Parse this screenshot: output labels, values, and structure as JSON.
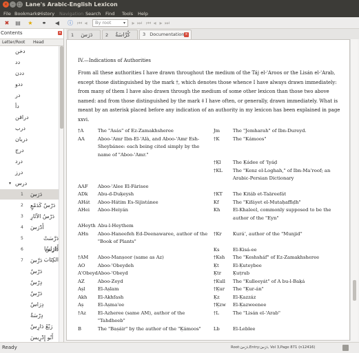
{
  "window": {
    "title": "Lane's Arabic-English Lexicon"
  },
  "menu": [
    "File",
    "Bookmarks",
    "History",
    "Navigation",
    "Search",
    "Find",
    "Tools",
    "Help"
  ],
  "menu_disabled": [
    false,
    false,
    false,
    true,
    false,
    false,
    false,
    false
  ],
  "toolbar": {
    "root_placeholder": "By root",
    "icons": [
      "delete-icon",
      "view-icon",
      "bookmark-icon",
      "binoculars-icon",
      "back-icon",
      "info-icon",
      "first-icon",
      "prev-icon",
      "next-icon",
      "last-icon",
      "page-first-icon",
      "page-prev-icon",
      "page-next-icon",
      "page-last-icon"
    ]
  },
  "tabs": [
    {
      "num": "1",
      "label": "دَرَسَ"
    },
    {
      "num": "2",
      "label": "كُرَّاسَةٌ"
    },
    {
      "num": "3",
      "label": "Documentation"
    }
  ],
  "left_panel": {
    "title": "Contents",
    "col_root": "Letter/Root",
    "col_head": "Head",
    "roots": [
      "دخن",
      "دد",
      "ددن",
      "ددو",
      "در",
      "دأ",
      "دراقن",
      "درب",
      "دربان",
      "درج",
      "درد",
      "درز",
      "درس"
    ],
    "expanded_arrow": "▾",
    "entries": [
      {
        "num": "1",
        "word": "دَرَسَ"
      },
      {
        "num": "2",
        "word": "دَرْسٌ كَدَمْعٍ"
      },
      {
        "num": "3",
        "word": "دَرْسُ الآثَارِ"
      },
      {
        "num": "4",
        "word": "أَدْرَسَ"
      },
      {
        "num": "5",
        "word": "دَرَّسَتْ أَدْرَاسًا"
      },
      {
        "num": "6",
        "word": "دَارَسَ الكِتَابَ"
      },
      {
        "num": "7",
        "word": "دَرَّسَ"
      },
      {
        "num": "",
        "word": "دَرْسٌ"
      },
      {
        "num": "",
        "word": "دِرْسٌ"
      },
      {
        "num": "",
        "word": "دَرْسٌ"
      },
      {
        "num": "",
        "word": "دِرَاسٌ"
      },
      {
        "num": "",
        "word": "دِرْسَةٌ"
      },
      {
        "num": "",
        "word": "رَبْعُ دَارِسٌ"
      },
      {
        "num": "",
        "word": "أَبُو إِدْرِيسَ"
      },
      {
        "num": "",
        "word": "تَدْرِيسٌ"
      }
    ]
  },
  "doc": {
    "heading": "IV.—Indications of Authorities",
    "paragraph": "From all these authorities I have drawn throughout the medium of the Táj el-'Aroos or the Lisán el-'Arab, except those distinguished by the mark †, which denotes those whence I have always drawn immediately: from many of them I have also drawn through the medium of some other lexicon than those two above named: and from those distinguished by the mark ‡ I have often, or generally, drawn immediately. What is meant by an asterisk placed before any indication of an authority in my lexicon has been explained in page xxvi.",
    "rows": [
      [
        "†A",
        "The \"Asás\" of Ez-Zamakhsheree",
        "Jm",
        "The \"Jemharah\" of Ibn-Dureyd."
      ],
      [
        "AA",
        "Aboo-'Amr Ibn-El-'Alà, and Aboo-'Amr Esh-Sheybánee: each being cited simply by the name of \"Aboo-'Amr.\"",
        "†K",
        "The \"Kámoos\""
      ],
      [
        "",
        "",
        "†Ḳl",
        "The Ḳádee of 'Iyáḍ"
      ],
      [
        "",
        "",
        "†KL",
        "The \"Kenz el-Loghah,\" of Ibn-Maʼroof; an Arabic-Persian Dictionary"
      ],
      [
        "AAF",
        "Aboo-'Alee El-Fárisee",
        "",
        ""
      ],
      [
        "ADk",
        "Abu-d-Duḳeysh",
        "†KT",
        "The Kitáb et-Taäreefát"
      ],
      [
        "AHát",
        "Aboo-Hátim Es-Sijistánee",
        "Kf",
        "The \"Kifáyet el-Mutaḥaffiḍh\""
      ],
      [
        "AHei",
        "Aboo-Heiyán",
        "Kh",
        "El-Khaleel, commonly supposed to be the author of the \"Eyn\""
      ],
      [
        "AHeyth",
        "Abu-l-Heythem",
        "",
        ""
      ],
      [
        "AHn",
        "Aboo-Haneefeh Ed-Deenawaree, author of the \"Book of Plants\"",
        "†Kr",
        "Kuráʼ, author of the \"Munjid\""
      ],
      [
        "",
        "",
        "Ks",
        "El-Kisá-ee"
      ],
      [
        "†AM",
        "Aboo-Manṣoor (same as Az)",
        "†Ksh",
        "The \"Keshsháf\" of Ez-Zamakhsheree"
      ],
      [
        "AO",
        "Aboo-'Obeydeh",
        "Ḳt",
        "El-Ḳuteybee"
      ],
      [
        "A'Obeyd",
        "Aboo-'Obeyd",
        "Ḳtr",
        "Ḳuṭrub"
      ],
      [
        "AZ",
        "Aboo-Zeyd",
        "†Kull",
        "The \"Kulleeyát\" of A bu-l-Baḳá"
      ],
      [
        "Aṣl",
        "El-Aṣlam",
        "†Ḳur",
        "The \"Ḳur-án\""
      ],
      [
        "Akh",
        "El-Akhfash",
        "Ḳz",
        "El-Ḳazzáz"
      ],
      [
        "Aṣ",
        "El-Aṣma'ee",
        "†Ḳzw",
        "El-Ḳazweenee"
      ],
      [
        "†Az",
        "El-Azheree (same AM), author of the \"Tahdheeb\"",
        "†L",
        "The \"Lisán el-'Arab\""
      ],
      [
        "B",
        "The \"Baṣáir\" by the author of the \"Ḳámoos\"",
        "Lb",
        "El-Leblee"
      ]
    ]
  },
  "status": {
    "text": "Ready",
    "location": "Root:دَرَسَ,Entry:دَرَسَ, Vol 3,Page 871 (n12416)"
  }
}
